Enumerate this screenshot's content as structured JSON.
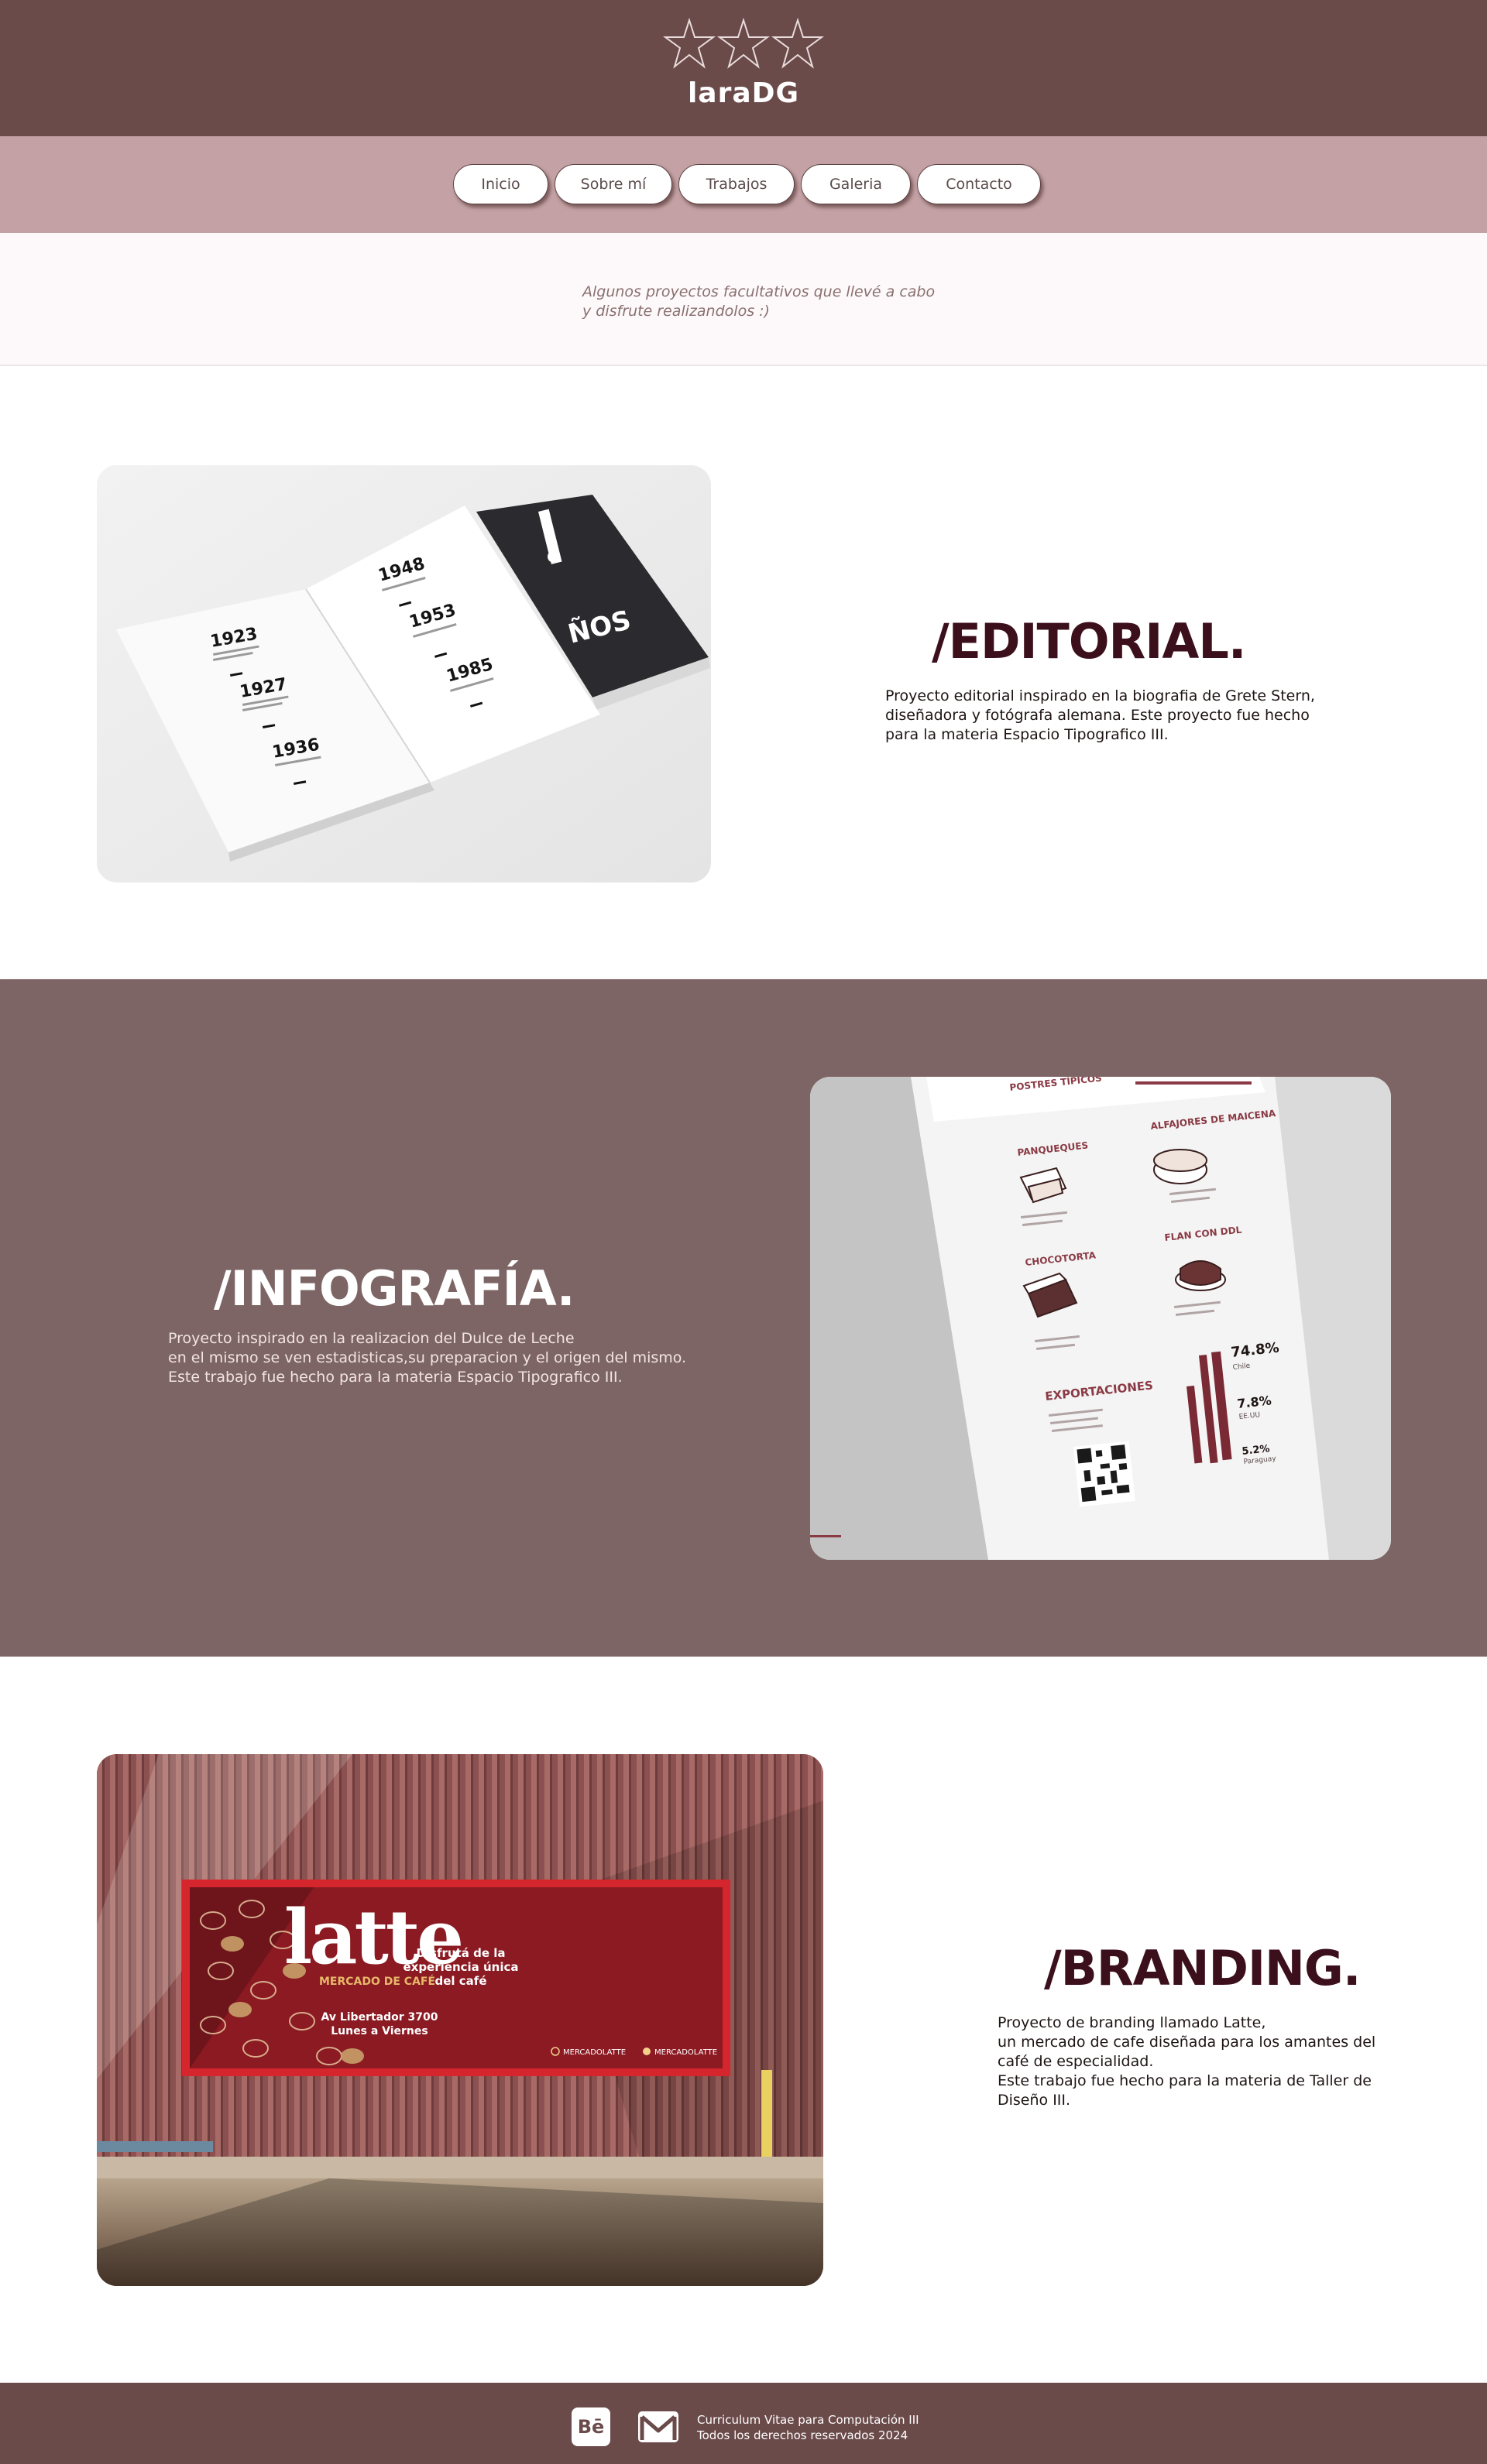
{
  "header": {
    "title": "laraDG"
  },
  "nav": {
    "items": [
      {
        "label": "Inicio"
      },
      {
        "label": "Sobre mí"
      },
      {
        "label": "Trabajos"
      },
      {
        "label": "Galeria"
      },
      {
        "label": "Contacto"
      }
    ]
  },
  "intro": {
    "line1": "Algunos proyectos facultativos que llevé a cabo",
    "line2": "y disfrute realizandolos :)"
  },
  "editorial": {
    "heading": "/EDITORIAL.",
    "desc_lines": [
      "Proyecto editorial inspirado en la biografia de Grete Stern,",
      "diseñadora y fotógrafa alemana. Este proyecto fue hecho",
      "para la materia Espacio Tipografico III."
    ],
    "book": {
      "years_left": [
        "1923",
        "1927",
        "1936"
      ],
      "years_right": [
        "1948",
        "1953",
        "1985"
      ],
      "cover_text": "ÑOS"
    }
  },
  "infografia": {
    "heading": "/INFOGRAFÍA.",
    "desc_lines": [
      "Proyecto inspirado en la realizacion del Dulce de Leche",
      "en el mismo se ven estadisticas,su preparacion y el origen del mismo.",
      "Este trabajo fue hecho para la materia Espacio Tipografico III."
    ],
    "poster": {
      "title": "POSTRES TÍPICOS",
      "items": [
        "PANQUEQUES",
        "ALFAJORES DE MAICENA",
        "CHOCOTORTA",
        "FLAN CON DDL"
      ],
      "exports_title": "EXPORTACIONES",
      "stats": [
        {
          "value": "74.8%",
          "label": "Chile"
        },
        {
          "value": "7.8%",
          "label": "EE.UU"
        },
        {
          "value": "5.2%",
          "label": "Paraguay"
        }
      ]
    }
  },
  "branding": {
    "heading": "/BRANDING.",
    "desc_lines": [
      "Proyecto de branding llamado Latte,",
      "un mercado de cafe diseñada para los amantes del",
      "café de especialidad.",
      "Este trabajo fue hecho para la materia de Taller de",
      "Diseño III."
    ],
    "billboard": {
      "brand": "latte",
      "subtitle": "MERCADO DE CAFÉ",
      "address1": "Av Libertador 3700",
      "address2": "Lunes a Viernes",
      "tagline1": "Disfrutá de la",
      "tagline2": "experiencia única",
      "tagline3": "del café",
      "social1": "MERCADOLATTE",
      "social2": "MERCADOLATTE"
    }
  },
  "footer": {
    "behance_label": "Bē",
    "line1": "Curriculum Vitae para Computación III",
    "line2": "Todos los derechos reservados 2024"
  },
  "colors": {
    "header_bg": "#6b4a4a",
    "nav_bg": "#c3a1a4",
    "section_mid_bg": "#7e6565",
    "heading": "#3c0f1c"
  }
}
